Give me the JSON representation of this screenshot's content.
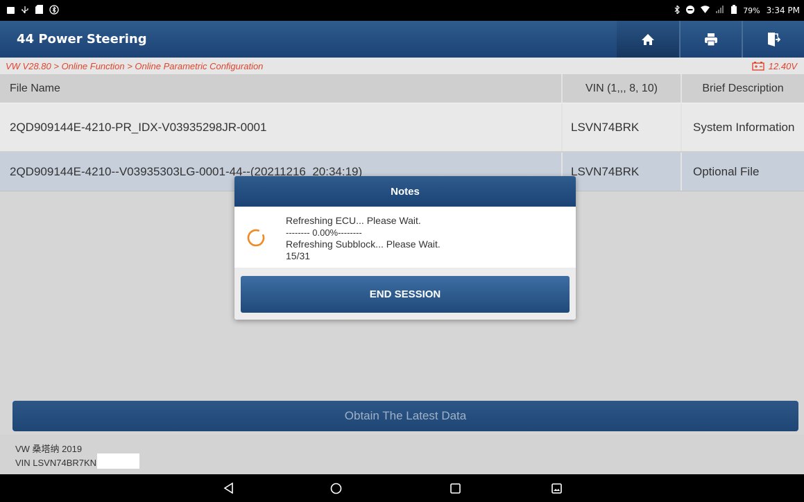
{
  "status_bar": {
    "battery": "79%",
    "time": "3:34 PM",
    "left_icons": [
      "image-icon",
      "usb-icon",
      "file-icon",
      "bluetooth-circle-icon"
    ],
    "right_icons": [
      "bluetooth-icon",
      "minus-circle-icon",
      "wifi-icon",
      "signal-icon",
      "battery-icon"
    ]
  },
  "header": {
    "title": "44 Power Steering",
    "buttons": [
      "home-icon",
      "print-icon",
      "exit-icon"
    ]
  },
  "breadcrumb": {
    "path": "VW V28.80 > Online Function > Online Parametric Configuration",
    "voltage": "12.40V"
  },
  "table": {
    "columns": [
      "File Name",
      "VIN (1,,, 8, 10)",
      "Brief Description"
    ],
    "rows": [
      {
        "file": "2QD909144E-4210-PR_IDX-V03935298JR-0001",
        "vin": "LSVN74BRK",
        "desc": "System Information"
      },
      {
        "file": "2QD909144E-4210--V03935303LG-0001-44--(20211216_20:34:19)",
        "vin": "LSVN74BRK",
        "desc": "Optional File"
      }
    ]
  },
  "obtain_button": "Obtain The Latest Data",
  "footer": {
    "vehicle": "VW 桑塔纳 2019",
    "vin": "VIN LSVN74BR7KN"
  },
  "dialog": {
    "title": "Notes",
    "line1": "Refreshing ECU... Please Wait.",
    "line2": "-------- 0.00%--------",
    "line3": "Refreshing Subblock... Please Wait.",
    "line4": "15/31",
    "button": "END SESSION",
    "spinner_color": "#f08a24"
  },
  "colors": {
    "header_blue": "#1c4375",
    "breadcrumb_red": "#e0442c",
    "selected_row": "#c7cfdb"
  }
}
